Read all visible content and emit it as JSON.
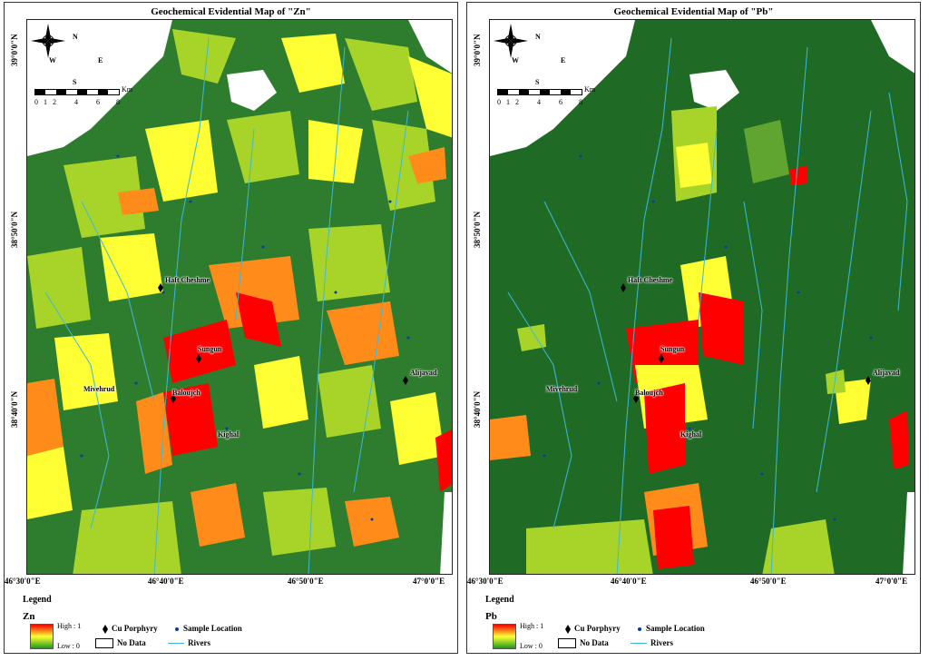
{
  "panels": [
    {
      "title": "Geochemical Evidential Map of \"Zn\"",
      "element": "Zn",
      "legend_title": "Legend",
      "ramp_high": "High : 1",
      "ramp_low": "Low : 0",
      "cu_porphyry": "Cu Porphyry",
      "sample_location": "Sample Location",
      "no_data": "No Data",
      "rivers": "Rivers"
    },
    {
      "title": "Geochemical Evidential Map of \"Pb\"",
      "element": "Pb",
      "legend_title": "Legend",
      "ramp_high": "High : 1",
      "ramp_low": "Low : 0",
      "cu_porphyry": "Cu Porphyry",
      "sample_location": "Sample Location",
      "no_data": "No Data",
      "rivers": "Rivers"
    }
  ],
  "latitude_labels": [
    "39°0'0\"N",
    "38°50'0\"N",
    "38°40'0\"N"
  ],
  "longitude_labels": [
    "46°30'0\"E",
    "46°40'0\"E",
    "46°50'0\"E",
    "47°0'0\"E"
  ],
  "compass": {
    "n": "N",
    "s": "S",
    "e": "E",
    "w": "W"
  },
  "scale": {
    "unit": "Km",
    "ticks": [
      "0",
      "1",
      "2",
      "4",
      "6",
      "8"
    ]
  },
  "places": [
    "Haft Cheshme",
    "Sungun",
    "Baloujch",
    "Mivehrud",
    "Alijavad",
    "Kighal"
  ],
  "colors": {
    "high": "#ff0000",
    "mid_high": "#ff8c1a",
    "mid": "#ffff33",
    "mid_low": "#a8d42a",
    "low": "#1a7a1a",
    "river": "#3db8d8",
    "sample": "#0a3aa8"
  }
}
